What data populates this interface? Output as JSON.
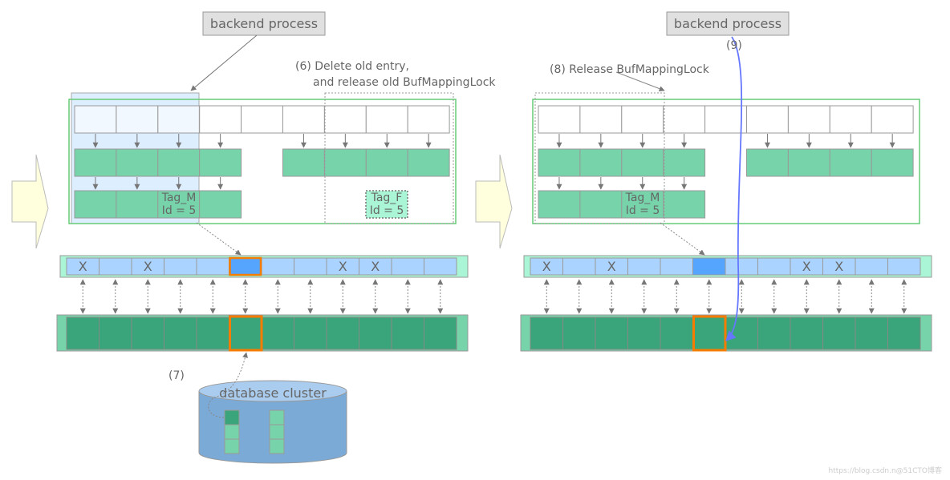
{
  "colors": {
    "slot": "#ffffff",
    "hash_entry": "#77d4aa",
    "descriptor": "#aad4ff",
    "descriptor_selected": "#55a5ff",
    "descriptor_frame": "#aaf5d5",
    "buffer_page": "#3aa57a",
    "buffer_frame": "#77d4aa",
    "highlight": "#f57c00",
    "lock_region": "#ddeeff",
    "cylinder": "#7aaad5",
    "cylinder_top": "#aaccee",
    "step9_arrow": "#6677ff",
    "backend_box": "#e0e0e0",
    "chevron": "#ffffdd"
  },
  "left": {
    "backend_label": "backend process",
    "step6_line1": "(6) Delete old entry,",
    "step6_line2": "and release old BufMappingLock",
    "tag_m_line1": "Tag_M",
    "tag_m_line2": "Id = 5",
    "tag_f_line1": "Tag_F",
    "tag_f_line2": "Id = 5",
    "descriptor_marks": [
      "X",
      "",
      "X",
      "",
      "",
      "",
      "",
      "",
      "X",
      "X",
      "",
      ""
    ],
    "selected_slot": 5,
    "step7_label": "(7)",
    "db_label": "database cluster"
  },
  "right": {
    "backend_label": "backend process",
    "step8_label": "(8) Release BufMappingLock",
    "step9_label": "(9)",
    "tag_m_line1": "Tag_M",
    "tag_m_line2": "Id = 5",
    "descriptor_marks": [
      "X",
      "",
      "X",
      "",
      "",
      "",
      "",
      "",
      "X",
      "X",
      "",
      ""
    ],
    "selected_slot": 5
  },
  "watermark": "https://blog.csdn.n@51CTO博客"
}
